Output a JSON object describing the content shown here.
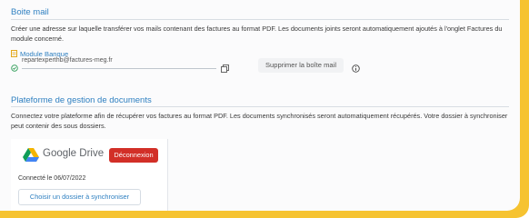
{
  "mailbox": {
    "title": "Boite mail",
    "description": "Créer une adresse sur laquelle transférer vos mails contenant des factures au format PDF. Les documents joints seront automatiquement ajoutés à l'onglet Factures du module concerné.",
    "module_label": "Module Banque",
    "email": "repartexperthb@factures-meg.fr",
    "remove_button": "Supprimer la boîte mail",
    "icons": [
      "document-icon",
      "check-circle-icon",
      "copy-icon",
      "info-icon"
    ]
  },
  "docs_platform": {
    "title": "Plateforme de gestion de documents",
    "description": "Connectez votre plateforme afin de récupérer vos factures au format PDF. Les documents synchronisés seront automatiquement récupérés. Votre dossier à synchroniser peut contenir des sous dossiers.",
    "provider": {
      "name": "Google Drive",
      "disconnect_button": "Déconnexion",
      "connected_text": "Connecté le 06/07/2022",
      "choose_folder_button": "Choisir un dossier à synchroniser"
    }
  },
  "colors": {
    "accent": "#2f80c1",
    "danger": "#d22f27",
    "highlight_border": "#f6c331"
  }
}
